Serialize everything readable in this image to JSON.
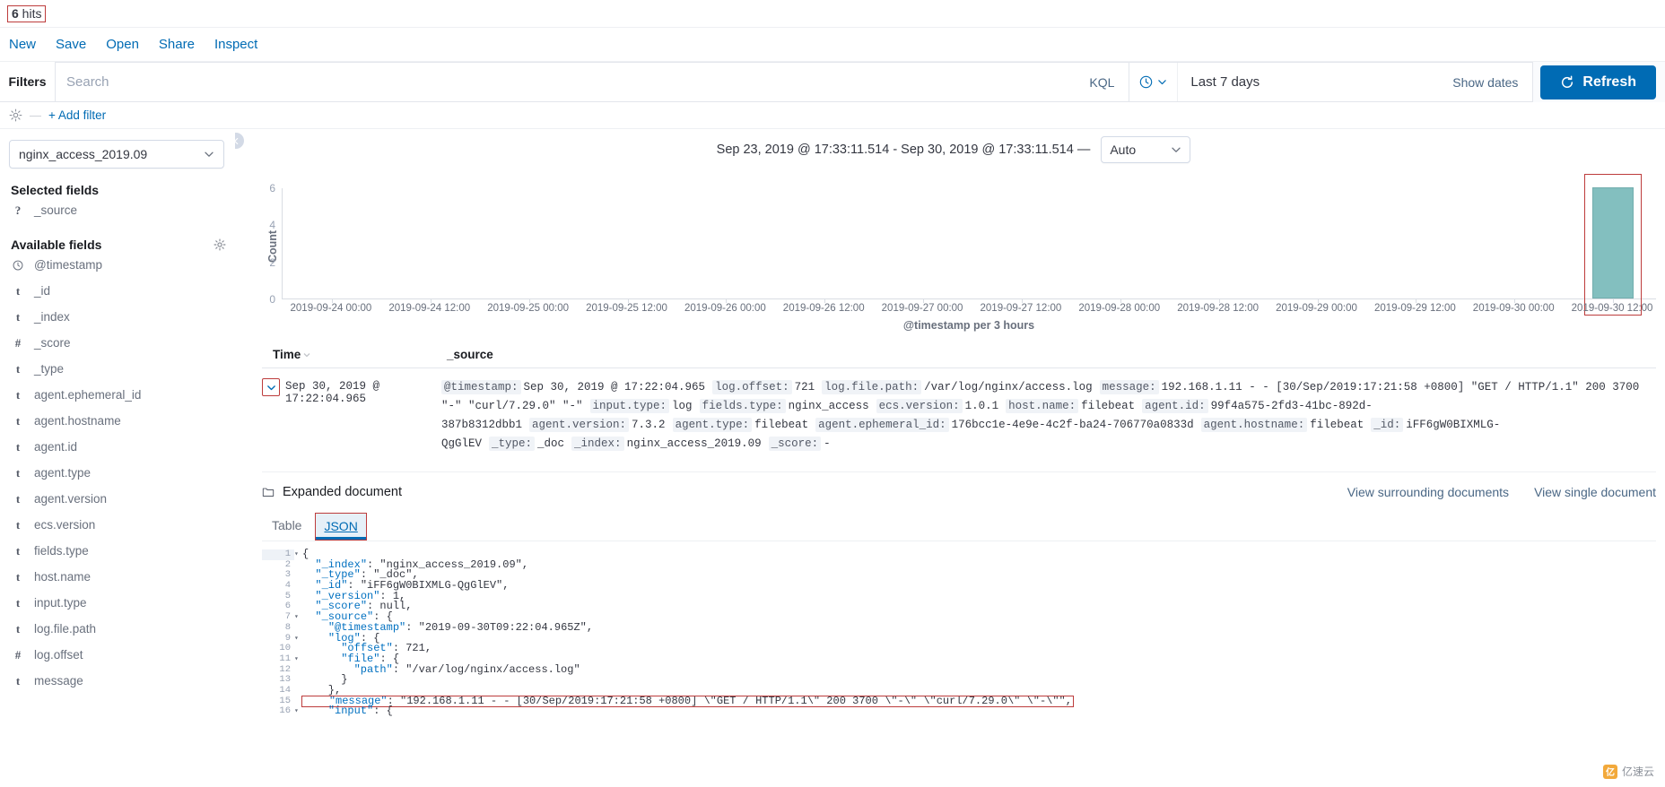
{
  "hits": {
    "count": "6",
    "label": " hits"
  },
  "topnav": {
    "items": [
      {
        "label": "New"
      },
      {
        "label": "Save"
      },
      {
        "label": "Open"
      },
      {
        "label": "Share"
      },
      {
        "label": "Inspect"
      }
    ]
  },
  "querybar": {
    "filters_label": "Filters",
    "search_placeholder": "Search",
    "search_value": "",
    "kql_label": "KQL",
    "time_value": "Last 7 days",
    "show_dates_label": "Show dates",
    "refresh_label": "Refresh"
  },
  "filterrow": {
    "add_filter_label": "+ Add filter",
    "dash": "—"
  },
  "sidebar": {
    "index_pattern": "nginx_access_2019.09",
    "selected_fields_title": "Selected fields",
    "available_fields_title": "Available fields",
    "selected_fields": [
      {
        "type": "?",
        "name": "_source"
      }
    ],
    "available_fields": [
      {
        "type": "clock",
        "name": "@timestamp"
      },
      {
        "type": "t",
        "name": "_id"
      },
      {
        "type": "t",
        "name": "_index"
      },
      {
        "type": "#",
        "name": "_score"
      },
      {
        "type": "t",
        "name": "_type"
      },
      {
        "type": "t",
        "name": "agent.ephemeral_id"
      },
      {
        "type": "t",
        "name": "agent.hostname"
      },
      {
        "type": "t",
        "name": "agent.id"
      },
      {
        "type": "t",
        "name": "agent.type"
      },
      {
        "type": "t",
        "name": "agent.version"
      },
      {
        "type": "t",
        "name": "ecs.version"
      },
      {
        "type": "t",
        "name": "fields.type"
      },
      {
        "type": "t",
        "name": "host.name"
      },
      {
        "type": "t",
        "name": "input.type"
      },
      {
        "type": "t",
        "name": "log.file.path"
      },
      {
        "type": "#",
        "name": "log.offset"
      },
      {
        "type": "t",
        "name": "message"
      }
    ]
  },
  "chart_header": {
    "range_text": "Sep 23, 2019 @ 17:33:11.514 - Sep 30, 2019 @ 17:33:11.514 —",
    "interval": "Auto"
  },
  "chart_data": {
    "type": "bar",
    "title": "",
    "xlabel": "@timestamp per 3 hours",
    "ylabel": "Count",
    "ylim": [
      0,
      6
    ],
    "yticks": [
      0,
      2,
      4,
      6
    ],
    "grid": false,
    "legend": "none",
    "categories": [
      "2019-09-24 00:00",
      "2019-09-24 12:00",
      "2019-09-25 00:00",
      "2019-09-25 12:00",
      "2019-09-26 00:00",
      "2019-09-26 12:00",
      "2019-09-27 00:00",
      "2019-09-27 12:00",
      "2019-09-28 00:00",
      "2019-09-28 12:00",
      "2019-09-29 00:00",
      "2019-09-29 12:00",
      "2019-09-30 00:00",
      "2019-09-30 12:00"
    ],
    "bars": [
      {
        "x": "2019-09-30 12:00",
        "value": 6,
        "color": "#6EB4B4",
        "highlighted": true
      }
    ],
    "bar_color": "#6EB4B4",
    "highlight_color": "#BD3C3C"
  },
  "doc_table": {
    "columns": [
      "Time",
      "_source"
    ],
    "row": {
      "time": "Sep 30, 2019 @ 17:22:04.965",
      "fields": [
        {
          "key": "@timestamp:",
          "value": "Sep 30, 2019 @ 17:22:04.965"
        },
        {
          "key": "log.offset:",
          "value": "721"
        },
        {
          "key": "log.file.path:",
          "value": "/var/log/nginx/access.log"
        },
        {
          "key": "message:",
          "value": "192.168.1.11 - - [30/Sep/2019:17:21:58 +0800] \"GET / HTTP/1.1\" 200 3700 \"-\" \"curl/7.29.0\" \"-\""
        },
        {
          "key": "input.type:",
          "value": "log"
        },
        {
          "key": "fields.type:",
          "value": "nginx_access"
        },
        {
          "key": "ecs.version:",
          "value": "1.0.1"
        },
        {
          "key": "host.name:",
          "value": "filebeat"
        },
        {
          "key": "agent.id:",
          "value": "99f4a575-2fd3-41bc-892d-387b8312dbb1"
        },
        {
          "key": "agent.version:",
          "value": "7.3.2"
        },
        {
          "key": "agent.type:",
          "value": "filebeat"
        },
        {
          "key": "agent.ephemeral_id:",
          "value": "176bcc1e-4e9e-4c2f-ba24-706770a0833d"
        },
        {
          "key": "agent.hostname:",
          "value": "filebeat"
        },
        {
          "key": "_id:",
          "value": "iFF6gW0BIXMLG-QgGlEV"
        },
        {
          "key": "_type:",
          "value": "_doc"
        },
        {
          "key": "_index:",
          "value": "nginx_access_2019.09"
        },
        {
          "key": "_score:",
          "value": "-"
        }
      ]
    }
  },
  "expanded_document": {
    "title": "Expanded document",
    "links": [
      {
        "label": "View surrounding documents"
      },
      {
        "label": "View single document"
      }
    ],
    "tabs": [
      {
        "label": "Table",
        "active": false
      },
      {
        "label": "JSON",
        "active": true
      }
    ],
    "json_lines": [
      {
        "n": 1,
        "fold": "▾",
        "text": "{"
      },
      {
        "n": 2,
        "fold": "",
        "text": "  \"_index\": \"nginx_access_2019.09\","
      },
      {
        "n": 3,
        "fold": "",
        "text": "  \"_type\": \"_doc\","
      },
      {
        "n": 4,
        "fold": "",
        "text": "  \"_id\": \"iFF6gW0BIXMLG-QgGlEV\","
      },
      {
        "n": 5,
        "fold": "",
        "text": "  \"_version\": 1,"
      },
      {
        "n": 6,
        "fold": "",
        "text": "  \"_score\": null,"
      },
      {
        "n": 7,
        "fold": "▾",
        "text": "  \"_source\": {"
      },
      {
        "n": 8,
        "fold": "",
        "text": "    \"@timestamp\": \"2019-09-30T09:22:04.965Z\","
      },
      {
        "n": 9,
        "fold": "▾",
        "text": "    \"log\": {"
      },
      {
        "n": 10,
        "fold": "",
        "text": "      \"offset\": 721,"
      },
      {
        "n": 11,
        "fold": "▾",
        "text": "      \"file\": {"
      },
      {
        "n": 12,
        "fold": "",
        "text": "        \"path\": \"/var/log/nginx/access.log\""
      },
      {
        "n": 13,
        "fold": "",
        "text": "      }"
      },
      {
        "n": 14,
        "fold": "",
        "text": "    },"
      },
      {
        "n": 15,
        "fold": "",
        "text": "    \"message\": \"192.168.1.11 - - [30/Sep/2019:17:21:58 +0800] \\\"GET / HTTP/1.1\\\" 200 3700 \\\"-\\\" \\\"curl/7.29.0\\\" \\\"-\\\"\",",
        "highlight": true
      },
      {
        "n": 16,
        "fold": "▾",
        "text": "    \"input\": {"
      }
    ]
  },
  "watermark": {
    "icon_text": "亿",
    "text": "亿速云"
  },
  "colors": {
    "accent": "#006BB4",
    "link": "#4a6785",
    "highlight": "#BD3C3C",
    "bar": "#6EB4B4"
  }
}
